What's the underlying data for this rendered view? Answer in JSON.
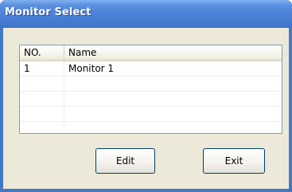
{
  "window": {
    "title": "Monitor Select"
  },
  "list": {
    "columns": [
      "NO.",
      "Name"
    ],
    "rows": [
      {
        "no": "1",
        "name": "Monitor 1"
      },
      {
        "no": "",
        "name": ""
      },
      {
        "no": "",
        "name": ""
      },
      {
        "no": "",
        "name": ""
      },
      {
        "no": "",
        "name": ""
      }
    ]
  },
  "buttons": {
    "edit_label": "Edit",
    "exit_label": "Exit"
  },
  "colors": {
    "titlebar": "#4a80d6",
    "client_background": "#ece9d8",
    "button_border": "#003c74"
  }
}
